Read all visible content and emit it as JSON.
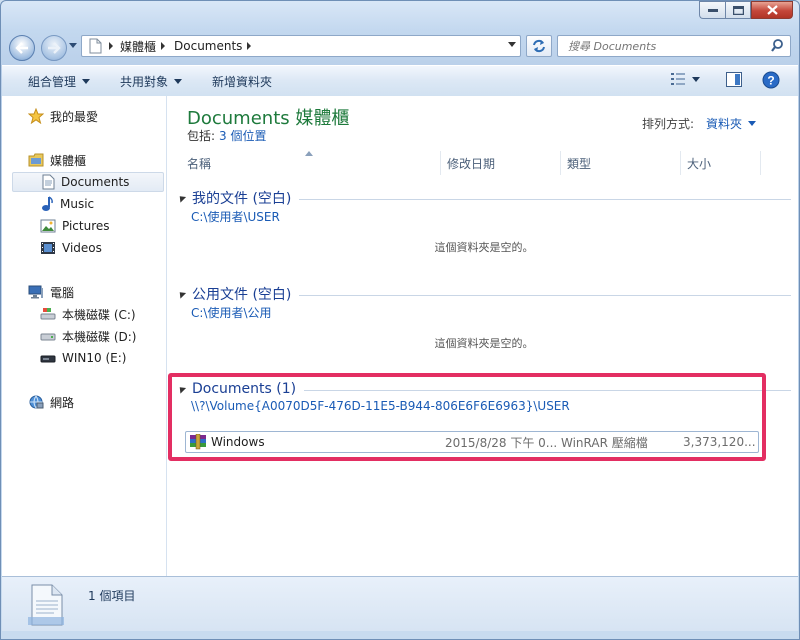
{
  "address": {
    "crumbs": [
      "媒體櫃",
      "Documents"
    ],
    "search_placeholder": "搜尋 Documents"
  },
  "toolbar": {
    "organize": "組合管理",
    "share": "共用對象",
    "new_folder": "新增資料夾"
  },
  "nav": {
    "favorites": "我的最愛",
    "libraries": "媒體櫃",
    "lib_items": [
      "Documents",
      "Music",
      "Pictures",
      "Videos"
    ],
    "computer": "電腦",
    "drives": [
      "本機磁碟 (C:)",
      "本機磁碟 (D:)",
      "WIN10 (E:)"
    ],
    "network": "網路"
  },
  "library": {
    "title": "Documents 媒體櫃",
    "includes_label": "包括:",
    "includes_link": "3 個位置",
    "arrange_label": "排列方式:",
    "arrange_value": "資料夾"
  },
  "columns": [
    "名稱",
    "修改日期",
    "類型",
    "大小"
  ],
  "groups": [
    {
      "title": "我的文件 (空白)",
      "path": "C:\\使用者\\USER",
      "empty_text": "這個資料夾是空的。"
    },
    {
      "title": "公用文件 (空白)",
      "path": "C:\\使用者\\公用",
      "empty_text": "這個資料夾是空的。"
    },
    {
      "title": "Documents (1)",
      "path": "\\\\?\\Volume{A0070D5F-476D-11E5-B944-806E6F6E6963}\\USER"
    }
  ],
  "file": {
    "name": "Windows",
    "date": "2015/8/28 下午 0...",
    "type": "WinRAR 壓縮檔",
    "size": "3,373,120..."
  },
  "status": {
    "count": "1 個項目"
  },
  "colors": {
    "highlight": "#e32e62",
    "library_title": "#1e7a3c",
    "group_title": "#1a3f94",
    "link": "#1a5bb5"
  }
}
